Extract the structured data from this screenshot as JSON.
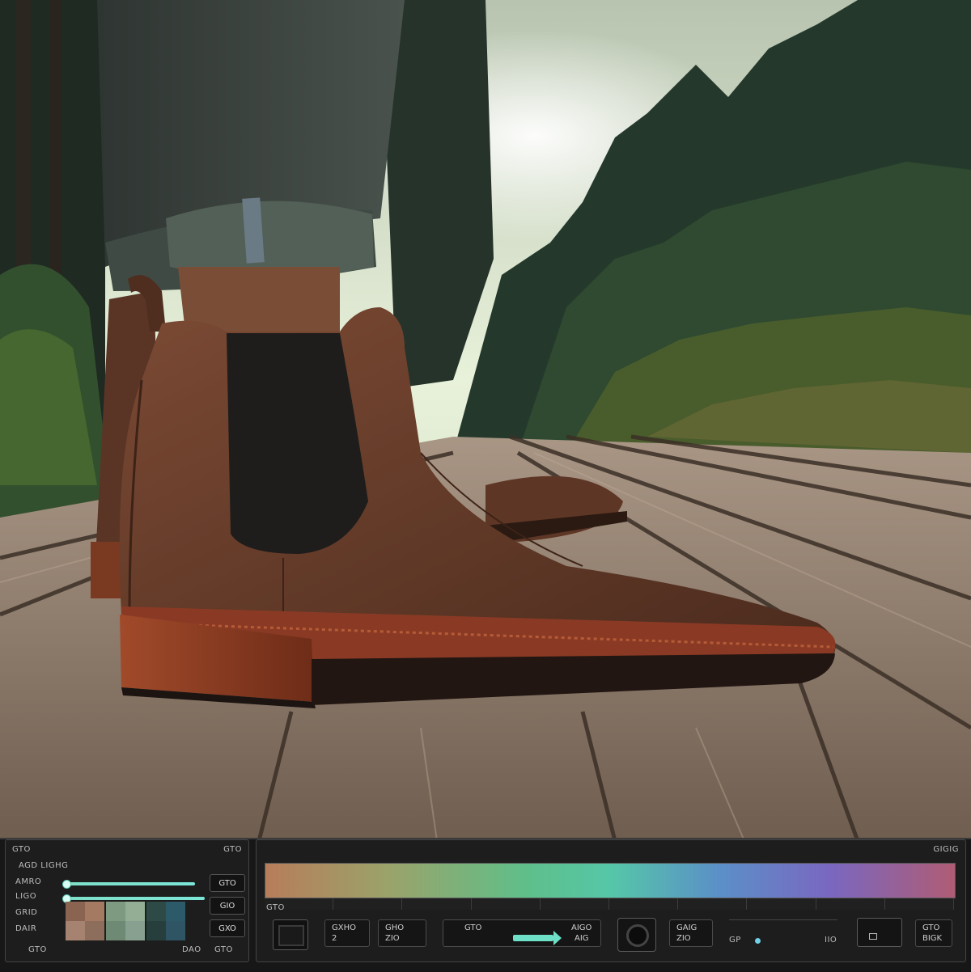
{
  "left_panel": {
    "corner_label": "GTO",
    "corner_value": "GTO",
    "title": "AGD LIGHG",
    "sliders": [
      {
        "label": "AMRO",
        "value_text": "GTO",
        "level": 0.95
      },
      {
        "label": "LIGO",
        "value_text": "GIO",
        "level": 1.0
      }
    ],
    "swatch_row_label_1": "GRID",
    "swatch_row_label_2": "DAIR",
    "swatch_value_text": "GXO",
    "swatch_colors": [
      "#8a6450",
      "#a57a62",
      "#7e9a80",
      "#93ae94",
      "#2e4a47",
      "#2c5a68",
      "#a58370",
      "#8d6e5c",
      "#6e8a74",
      "#88a090",
      "#263f3d",
      "#2f5565"
    ],
    "footer": [
      "GTO",
      "DAO",
      "GTO"
    ]
  },
  "right_panel": {
    "header_value": "GIGIG",
    "section_label": "GTO",
    "controls": [
      {
        "line1": "GXHO",
        "line2": "2"
      },
      {
        "line1": "GHO",
        "line2": "ZIO"
      },
      {
        "line1": "GTO",
        "line2": ""
      },
      {
        "line1": "AIGO",
        "line2": "AIG"
      },
      {
        "line1": "GAIG",
        "line2": "ZIO"
      },
      {
        "line1": "GP",
        "line2": ""
      },
      {
        "line1": "IIO",
        "line2": ""
      },
      {
        "line1": "GTO",
        "line2": "BIGK"
      }
    ]
  },
  "colors": {
    "accent": "#6fe0c8",
    "panel_bg": "#1d1d1d",
    "boot": "#6b3f2c",
    "sole": "#8a3a24",
    "wood": "#8f7b68"
  }
}
